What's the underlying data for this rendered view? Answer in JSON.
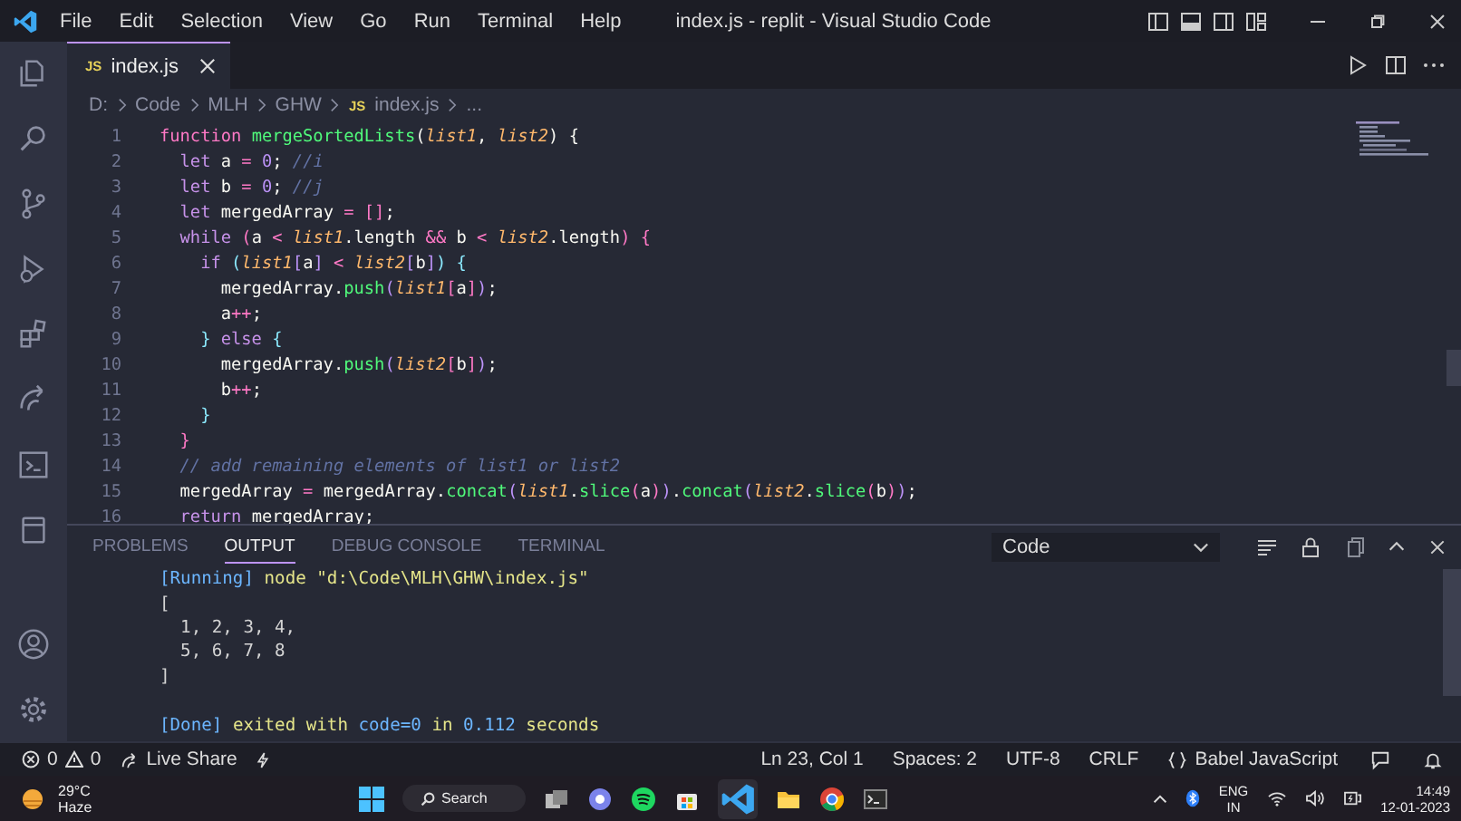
{
  "menu_bar": {
    "items": [
      "File",
      "Edit",
      "Selection",
      "View",
      "Go",
      "Run",
      "Terminal",
      "Help"
    ]
  },
  "window": {
    "title": "index.js - replit - Visual Studio Code"
  },
  "tabs": [
    {
      "icon_text": "JS",
      "label": "index.js",
      "selected": true
    }
  ],
  "breadcrumbs": [
    {
      "label": "D:"
    },
    {
      "label": "Code"
    },
    {
      "label": "MLH"
    },
    {
      "label": "GHW"
    },
    {
      "icon_text": "JS",
      "label": "index.js"
    },
    {
      "label": "..."
    }
  ],
  "editor": {
    "lines": [
      {
        "n": "1",
        "tokens": [
          {
            "kind": "kw2",
            "t": "function "
          },
          {
            "kind": "fn",
            "t": "mergeSortedLists"
          },
          {
            "kind": "txt",
            "t": "("
          },
          {
            "kind": "param",
            "t": "list1"
          },
          {
            "kind": "txt",
            "t": ", "
          },
          {
            "kind": "param",
            "t": "list2"
          },
          {
            "kind": "txt",
            "t": ") {"
          }
        ]
      },
      {
        "n": "2",
        "tokens": [
          {
            "kind": "kw",
            "t": "  let "
          },
          {
            "kind": "txt",
            "t": "a "
          },
          {
            "kind": "op",
            "t": "= "
          },
          {
            "kind": "num",
            "t": "0"
          },
          {
            "kind": "txt",
            "t": "; "
          },
          {
            "kind": "cmt",
            "t": "//i"
          }
        ]
      },
      {
        "n": "3",
        "tokens": [
          {
            "kind": "kw",
            "t": "  let "
          },
          {
            "kind": "txt",
            "t": "b "
          },
          {
            "kind": "op",
            "t": "= "
          },
          {
            "kind": "num",
            "t": "0"
          },
          {
            "kind": "txt",
            "t": "; "
          },
          {
            "kind": "cmt",
            "t": "//j"
          }
        ]
      },
      {
        "n": "4",
        "tokens": [
          {
            "kind": "kw",
            "t": "  let "
          },
          {
            "kind": "txt",
            "t": "mergedArray "
          },
          {
            "kind": "op",
            "t": "= "
          },
          {
            "kind": "b1",
            "t": "[]"
          },
          {
            "kind": "txt",
            "t": ";"
          }
        ]
      },
      {
        "n": "5",
        "tokens": [
          {
            "kind": "kw",
            "t": "  while "
          },
          {
            "kind": "b1",
            "t": "("
          },
          {
            "kind": "txt",
            "t": "a "
          },
          {
            "kind": "op",
            "t": "< "
          },
          {
            "kind": "param",
            "t": "list1"
          },
          {
            "kind": "txt",
            "t": ".length "
          },
          {
            "kind": "op",
            "t": "&& "
          },
          {
            "kind": "txt",
            "t": "b "
          },
          {
            "kind": "op",
            "t": "< "
          },
          {
            "kind": "param",
            "t": "list2"
          },
          {
            "kind": "txt",
            "t": ".length"
          },
          {
            "kind": "b1",
            "t": ") {"
          }
        ]
      },
      {
        "n": "6",
        "tokens": [
          {
            "kind": "kw",
            "t": "    if "
          },
          {
            "kind": "b2",
            "t": "("
          },
          {
            "kind": "param",
            "t": "list1"
          },
          {
            "kind": "b3",
            "t": "["
          },
          {
            "kind": "txt",
            "t": "a"
          },
          {
            "kind": "b3",
            "t": "] "
          },
          {
            "kind": "op",
            "t": "< "
          },
          {
            "kind": "param",
            "t": "list2"
          },
          {
            "kind": "b3",
            "t": "["
          },
          {
            "kind": "txt",
            "t": "b"
          },
          {
            "kind": "b3",
            "t": "]"
          },
          {
            "kind": "b2",
            "t": ") {"
          }
        ]
      },
      {
        "n": "7",
        "tokens": [
          {
            "kind": "txt",
            "t": "      mergedArray."
          },
          {
            "kind": "fn",
            "t": "push"
          },
          {
            "kind": "b3",
            "t": "("
          },
          {
            "kind": "param",
            "t": "list1"
          },
          {
            "kind": "b1",
            "t": "["
          },
          {
            "kind": "txt",
            "t": "a"
          },
          {
            "kind": "b1",
            "t": "]"
          },
          {
            "kind": "b3",
            "t": ")"
          },
          {
            "kind": "txt",
            "t": ";"
          }
        ]
      },
      {
        "n": "8",
        "tokens": [
          {
            "kind": "txt",
            "t": "      a"
          },
          {
            "kind": "op",
            "t": "++"
          },
          {
            "kind": "txt",
            "t": ";"
          }
        ]
      },
      {
        "n": "9",
        "tokens": [
          {
            "kind": "b2",
            "t": "    } "
          },
          {
            "kind": "kw",
            "t": "else "
          },
          {
            "kind": "b2",
            "t": "{"
          }
        ]
      },
      {
        "n": "10",
        "tokens": [
          {
            "kind": "txt",
            "t": "      mergedArray."
          },
          {
            "kind": "fn",
            "t": "push"
          },
          {
            "kind": "b3",
            "t": "("
          },
          {
            "kind": "param",
            "t": "list2"
          },
          {
            "kind": "b1",
            "t": "["
          },
          {
            "kind": "txt",
            "t": "b"
          },
          {
            "kind": "b1",
            "t": "]"
          },
          {
            "kind": "b3",
            "t": ")"
          },
          {
            "kind": "txt",
            "t": ";"
          }
        ]
      },
      {
        "n": "11",
        "tokens": [
          {
            "kind": "txt",
            "t": "      b"
          },
          {
            "kind": "op",
            "t": "++"
          },
          {
            "kind": "txt",
            "t": ";"
          }
        ]
      },
      {
        "n": "12",
        "tokens": [
          {
            "kind": "b2",
            "t": "    }"
          }
        ]
      },
      {
        "n": "13",
        "tokens": [
          {
            "kind": "b1",
            "t": "  }"
          }
        ]
      },
      {
        "n": "14",
        "tokens": [
          {
            "kind": "cmt",
            "t": "  // add remaining elements of list1 or list2"
          }
        ]
      },
      {
        "n": "15",
        "tokens": [
          {
            "kind": "txt",
            "t": "  mergedArray "
          },
          {
            "kind": "op",
            "t": "= "
          },
          {
            "kind": "txt",
            "t": "mergedArray."
          },
          {
            "kind": "fn",
            "t": "concat"
          },
          {
            "kind": "b3",
            "t": "("
          },
          {
            "kind": "param",
            "t": "list1"
          },
          {
            "kind": "txt",
            "t": "."
          },
          {
            "kind": "fn",
            "t": "slice"
          },
          {
            "kind": "b1",
            "t": "("
          },
          {
            "kind": "txt",
            "t": "a"
          },
          {
            "kind": "b1",
            "t": ")"
          },
          {
            "kind": "b3",
            "t": ")"
          },
          {
            "kind": "txt",
            "t": "."
          },
          {
            "kind": "fn",
            "t": "concat"
          },
          {
            "kind": "b3",
            "t": "("
          },
          {
            "kind": "param",
            "t": "list2"
          },
          {
            "kind": "txt",
            "t": "."
          },
          {
            "kind": "fn",
            "t": "slice"
          },
          {
            "kind": "b1",
            "t": "("
          },
          {
            "kind": "txt",
            "t": "b"
          },
          {
            "kind": "b1",
            "t": ")"
          },
          {
            "kind": "b3",
            "t": ")"
          },
          {
            "kind": "txt",
            "t": ";"
          }
        ]
      },
      {
        "n": "16",
        "tokens": [
          {
            "kind": "kw",
            "t": "  return "
          },
          {
            "kind": "txt",
            "t": "mergedArray;"
          }
        ]
      }
    ]
  },
  "panel": {
    "tabs": [
      {
        "label": "PROBLEMS",
        "selected": false
      },
      {
        "label": "OUTPUT",
        "selected": true
      },
      {
        "label": "DEBUG CONSOLE",
        "selected": false
      },
      {
        "label": "TERMINAL",
        "selected": false
      }
    ],
    "dropdown": {
      "value": "Code"
    },
    "output": [
      {
        "kind": "text",
        "tokens": [
          {
            "kind": "tag",
            "t": "[Running] "
          },
          {
            "kind": "str",
            "t": "node \"d:\\Code\\MLH\\GHW\\index.js\""
          }
        ]
      },
      {
        "kind": "text",
        "tokens": [
          {
            "kind": "plain",
            "t": "["
          }
        ]
      },
      {
        "kind": "text",
        "tokens": [
          {
            "kind": "plain",
            "t": "  1, 2, 3, 4,"
          }
        ]
      },
      {
        "kind": "text",
        "tokens": [
          {
            "kind": "plain",
            "t": "  5, 6, 7, 8"
          }
        ]
      },
      {
        "kind": "text",
        "tokens": [
          {
            "kind": "plain",
            "t": "]"
          }
        ]
      },
      {
        "kind": "blank"
      },
      {
        "kind": "text",
        "tokens": [
          {
            "kind": "tag",
            "t": "[Done] "
          },
          {
            "kind": "str",
            "t": "exited with "
          },
          {
            "kind": "tag",
            "t": "code=0 "
          },
          {
            "kind": "str",
            "t": "in "
          },
          {
            "kind": "tag",
            "t": "0.112 "
          },
          {
            "kind": "str",
            "t": "seconds"
          }
        ]
      }
    ]
  },
  "status_bar": {
    "errors": "0",
    "warnings": "0",
    "live_share": "Live Share",
    "position": "Ln 23, Col 1",
    "spaces": "Spaces: 2",
    "encoding": "UTF-8",
    "eol": "CRLF",
    "language": "Babel JavaScript"
  },
  "taskbar": {
    "temperature": "29°C",
    "weather": "Haze",
    "search": "Search",
    "language": "ENG",
    "region": "IN",
    "time": "14:49",
    "date": "12-01-2023"
  }
}
